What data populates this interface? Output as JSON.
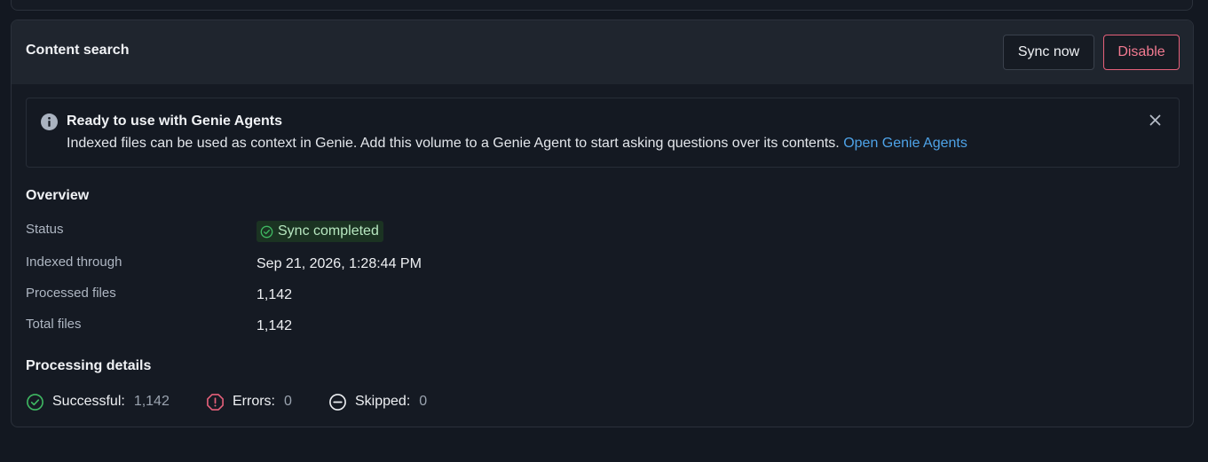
{
  "card": {
    "title": "Content search",
    "sync_button": "Sync now",
    "disable_button": "Disable"
  },
  "banner": {
    "title": "Ready to use with Genie Agents",
    "body": "Indexed files can be used as context in Genie. Add this volume to a Genie Agent to start asking questions over its contents.",
    "link": "Open Genie Agents"
  },
  "overview": {
    "title": "Overview",
    "status_label": "Status",
    "status_value": "Sync completed",
    "indexed_label": "Indexed through",
    "indexed_value": "Sep 21, 2026, 1:28:44 PM",
    "processed_label": "Processed files",
    "processed_value": "1,142",
    "total_label": "Total files",
    "total_value": "1,142"
  },
  "processing": {
    "title": "Processing details",
    "successful_label": "Successful:",
    "successful_value": "1,142",
    "errors_label": "Errors:",
    "errors_value": "0",
    "skipped_label": "Skipped:",
    "skipped_value": "0"
  },
  "colors": {
    "success": "#3fb862",
    "error": "#e5607a",
    "link": "#4ea3e8",
    "badge_bg": "#1b3322"
  },
  "icons": [
    "info-icon",
    "close-icon",
    "check-circle-icon",
    "error-octagon-icon",
    "skip-circle-icon"
  ]
}
